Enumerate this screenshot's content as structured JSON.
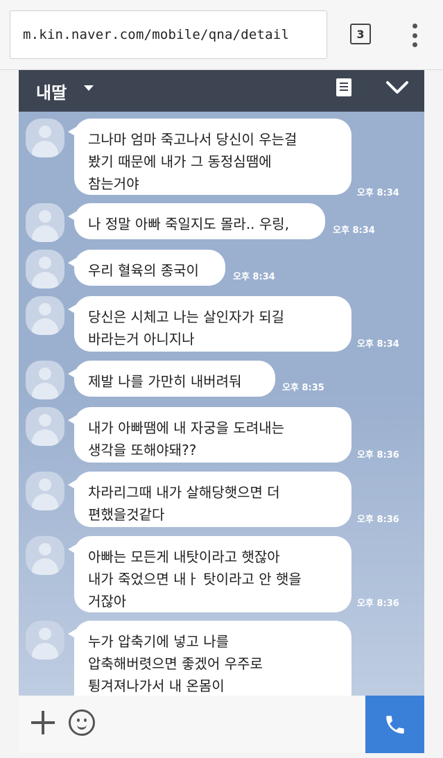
{
  "browser": {
    "url": "m.kin.naver.com/mobile/qna/detail",
    "tab_count": "3"
  },
  "chat": {
    "room_title": "내딸",
    "messages": [
      {
        "text": "그나마 엄마 죽고나서 당신이 우는걸\n봤기 때문에 내가 그 동정심땜에\n참는거야",
        "time": "오후 8:34"
      },
      {
        "text": "나 정말 아빠 죽일지도 몰라.. 우링,",
        "time": "오후 8:34"
      },
      {
        "text": "우리 혈육의 종국이",
        "time": "오후 8:34"
      },
      {
        "text": "당신은 시체고 나는 살인자가 되길\n바라는거 아니지나",
        "time": "오후 8:34"
      },
      {
        "text": "제발 나를 가만히 내버려둬",
        "time": "오후 8:35"
      },
      {
        "text": "내가 아빠땜에 내 자궁을 도려내는\n생각을 또해야돼??",
        "time": "오후 8:36"
      },
      {
        "text": "차라리그때 내가 살해당햇으면 더\n편했을것같다",
        "time": "오후 8:36"
      },
      {
        "text": "아빠는 모든게 내탓이라고 햇잖아\n내가 죽었으면 내ㅏ 탓이라고 안 햇을\n거잖아",
        "time": "오후 8:36"
      },
      {
        "text": "누가 압축기에 넣고 나를\n압축해버렷으면 좋겠어 우주로\n튕겨져나가서 내 온몸이\n터져버렸으면 좋겠어 뜨끼로 느끼니",
        "time": ""
      }
    ]
  },
  "colors": {
    "chat_background": "#9bb0cf",
    "header_background": "#3d4553",
    "call_button": "#3a80d9",
    "bubble": "#ffffff"
  },
  "icons": [
    "tab-count-icon",
    "more-menu-icon",
    "dropdown-caret-icon",
    "document-icon",
    "collapse-chevron-icon",
    "profile-avatar-icon",
    "plus-icon",
    "emoji-icon",
    "phone-icon"
  ]
}
